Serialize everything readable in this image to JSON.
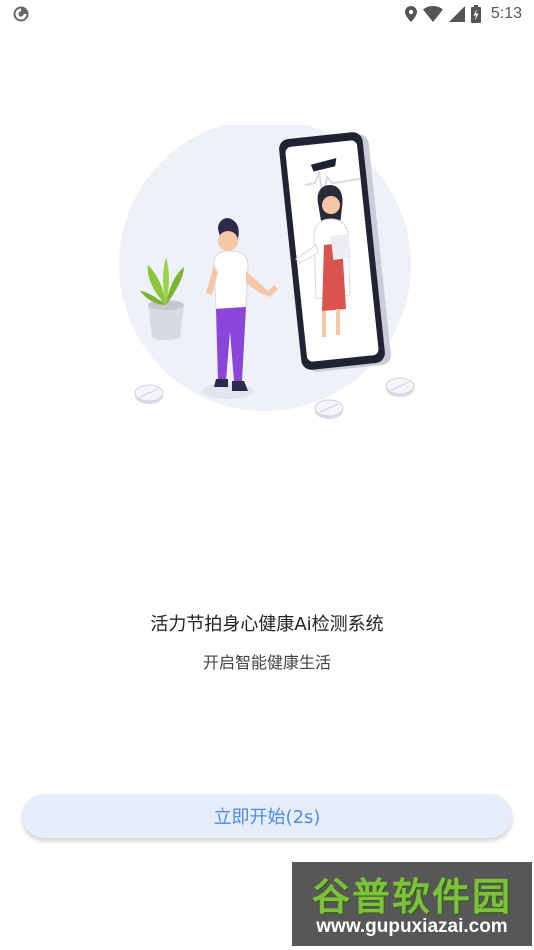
{
  "status_bar": {
    "time": "5:13",
    "icons": [
      "app-notification-icon",
      "location-icon",
      "wifi-icon",
      "signal-icon",
      "battery-charging-icon"
    ]
  },
  "illustration": {
    "description_icon": "doctor-video-consultation-illustration"
  },
  "headline": "活力节拍身心健康Ai检测系统",
  "subtitle": "开启智能健康生活",
  "start_button": {
    "label": "立即开始(2s)"
  },
  "watermark": {
    "title": "谷普软件园",
    "url": "www.gupuxiazai.com"
  },
  "colors": {
    "accent": "#4b8ee8",
    "button_bg": "#e7ecfb",
    "circle_bg": "#eef1f8",
    "person_pants": "#8b45d8",
    "doctor_skirt": "#d9534f",
    "plant": "#8cc63f"
  }
}
